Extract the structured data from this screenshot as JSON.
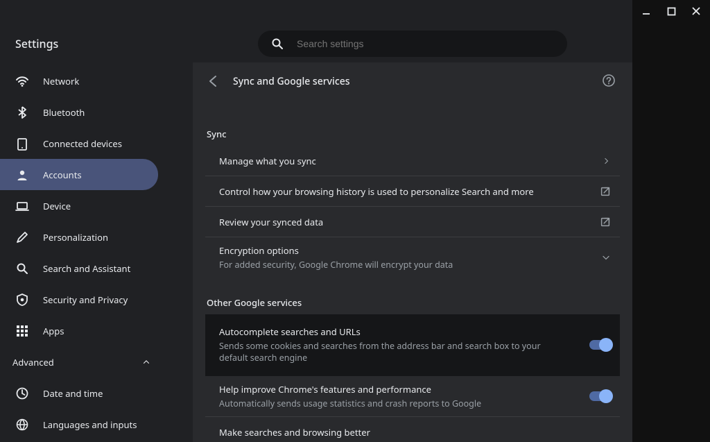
{
  "header": {
    "title": "Settings",
    "search_placeholder": "Search settings"
  },
  "sidebar": {
    "items": [
      {
        "icon": "wifi",
        "label": "Network"
      },
      {
        "icon": "bluetooth",
        "label": "Bluetooth"
      },
      {
        "icon": "devices",
        "label": "Connected devices"
      },
      {
        "icon": "person",
        "label": "Accounts",
        "active": true
      },
      {
        "icon": "laptop",
        "label": "Device"
      },
      {
        "icon": "pencil",
        "label": "Personalization"
      },
      {
        "icon": "search",
        "label": "Search and Assistant"
      },
      {
        "icon": "shield",
        "label": "Security and Privacy"
      },
      {
        "icon": "apps",
        "label": "Apps"
      }
    ],
    "advanced_label": "Advanced",
    "secondary_items": [
      {
        "icon": "clock",
        "label": "Date and time"
      },
      {
        "icon": "globe",
        "label": "Languages and inputs"
      }
    ]
  },
  "page": {
    "title": "Sync and Google services",
    "section_sync": "Sync",
    "section_other": "Other Google services",
    "rows": {
      "manage_sync": {
        "primary": "Manage what you sync"
      },
      "history": {
        "primary": "Control how your browsing history is used to personalize Search and more"
      },
      "review": {
        "primary": "Review your synced data"
      },
      "encryption": {
        "primary": "Encryption options",
        "secondary": "For added security, Google Chrome will encrypt your data"
      },
      "autocomplete": {
        "primary": "Autocomplete searches and URLs",
        "secondary": "Sends some cookies and searches from the address bar and search box to your default search engine",
        "toggle": true
      },
      "improve": {
        "primary": "Help improve Chrome's features and performance",
        "secondary": "Automatically sends usage statistics and crash reports to Google",
        "toggle": true
      },
      "better": {
        "primary": "Make searches and browsing better"
      }
    }
  }
}
